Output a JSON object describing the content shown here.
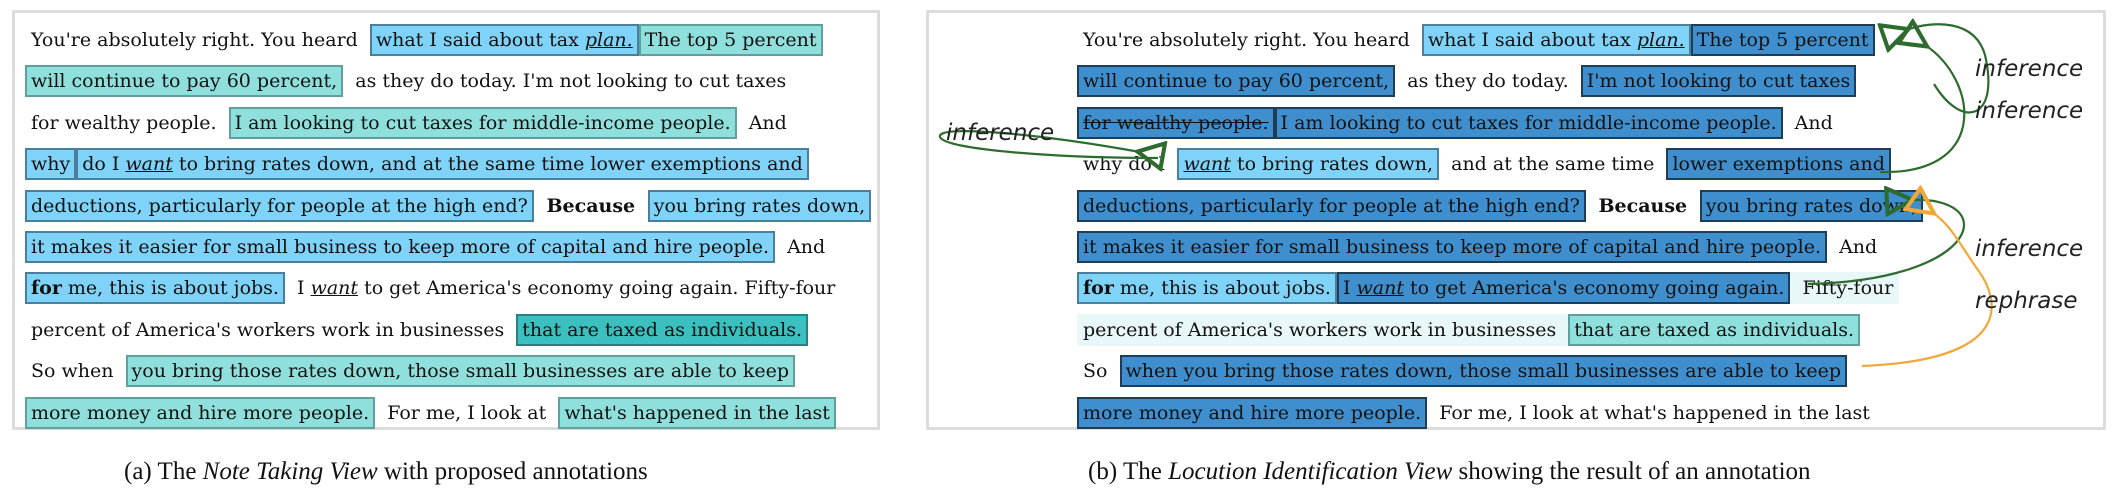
{
  "panel_a": {
    "lines": [
      [
        {
          "t": "You're absolutely right. You heard ",
          "c": "plain"
        },
        {
          "t": "what I said about tax ",
          "c": "light",
          "tail": "plan.",
          "tail_style": "it"
        },
        {
          "t": "The top 5 percent",
          "c": "teal"
        }
      ],
      [
        {
          "t": "will continue to pay 60 percent,",
          "c": "teal"
        },
        {
          "t": " as they do today. I'm not looking to cut taxes",
          "c": "plain"
        }
      ],
      [
        {
          "t": "for wealthy people. ",
          "c": "plain"
        },
        {
          "t": "I am looking to cut taxes for middle-income people.",
          "c": "teal"
        },
        {
          "t": " And",
          "c": "plain"
        }
      ],
      [
        {
          "t": "why",
          "c": "light"
        },
        {
          "t": "do I ",
          "c": "light",
          "tail": "want",
          "tail_style": "it",
          "after": " to bring rates down, and at the same time lower exemptions and"
        }
      ],
      [
        {
          "t": "deductions, particularly for people at the high end?",
          "c": "light"
        },
        {
          "t": " Because ",
          "c": "plain",
          "bold": true
        },
        {
          "t": "you bring rates down,",
          "c": "light"
        }
      ],
      [
        {
          "t": "it makes it easier for small business to keep more of capital and hire people.",
          "c": "light"
        },
        {
          "t": " And",
          "c": "plain"
        }
      ],
      [
        {
          "t": "for",
          "c": "light",
          "bold_head": true,
          "after": " me, this is about jobs."
        },
        {
          "t": " I ",
          "c": "plain",
          "tail": "want",
          "tail_style": "it",
          "after": " to get America's economy going again. Fifty-four"
        }
      ],
      [
        {
          "t": "percent of America's workers work in businesses ",
          "c": "plain"
        },
        {
          "t": "that are taxed as individuals.",
          "c": "teal2"
        }
      ],
      [
        {
          "t": "So when ",
          "c": "plain"
        },
        {
          "t": "you bring those rates down, those small businesses are able to keep",
          "c": "teal"
        }
      ],
      [
        {
          "t": "more money and hire more people.",
          "c": "teal"
        },
        {
          "t": " For me, I look at ",
          "c": "plain"
        },
        {
          "t": "what's happened in the last",
          "c": "teal"
        }
      ]
    ]
  },
  "panel_b": {
    "lines": [
      [
        {
          "t": "You're absolutely right. You heard ",
          "c": "plain"
        },
        {
          "t": "what I said about tax ",
          "c": "light",
          "tail": "plan.",
          "tail_style": "it"
        },
        {
          "t": "The top 5 percent",
          "c": "dark"
        }
      ],
      [
        {
          "t": "will continue to pay 60 percent,",
          "c": "dark"
        },
        {
          "t": " as they do today. ",
          "c": "plain"
        },
        {
          "t": "I'm not looking to cut taxes",
          "c": "dark"
        }
      ],
      [
        {
          "t": "for wealthy people.",
          "c": "dark",
          "strike": true
        },
        {
          "t": "I am looking to cut taxes for middle-income people.",
          "c": "dark"
        },
        {
          "t": " And",
          "c": "plain"
        }
      ],
      [
        {
          "t": "why do I ",
          "c": "plain"
        },
        {
          "t": "want",
          "c": "light",
          "tail_only_it": true,
          "after": " to bring rates down,"
        },
        {
          "t": " and at the same time ",
          "c": "plain"
        },
        {
          "t": "lower exemptions and",
          "c": "dark"
        }
      ],
      [
        {
          "t": "deductions, particularly for people at the high end?",
          "c": "dark"
        },
        {
          "t": " Because ",
          "c": "plain",
          "bold": true
        },
        {
          "t": "you bring rates down,",
          "c": "dark"
        }
      ],
      [
        {
          "t": "it makes it easier for small business to keep more of capital and hire people.",
          "c": "dark"
        },
        {
          "t": " And",
          "c": "plain"
        }
      ],
      [
        {
          "t": "for",
          "c": "light",
          "bold_head": true,
          "after": " me, this is about jobs."
        },
        {
          "t": "I ",
          "c": "dark",
          "tail": "want",
          "tail_style": "it",
          "after": " to get America's economy going again."
        },
        {
          "t": " Fifty-four",
          "c": "pale"
        }
      ],
      [
        {
          "t": "percent of America's workers work in businesses ",
          "c": "pale"
        },
        {
          "t": "that are taxed as individuals.",
          "c": "teal"
        }
      ],
      [
        {
          "t": "So ",
          "c": "plain"
        },
        {
          "t": "when you bring those rates down, those small businesses are able to keep",
          "c": "dark"
        }
      ],
      [
        {
          "t": "more money and hire more people.",
          "c": "dark"
        },
        {
          "t": " For me, I look at what's happened in the last",
          "c": "plain"
        }
      ]
    ],
    "relations": [
      {
        "label": "inference",
        "color": "#2e6b2e"
      },
      {
        "label": "inference",
        "color": "#2e6b2e"
      },
      {
        "label": "inference",
        "color": "#2e6b2e"
      },
      {
        "label": "inference",
        "color": "#2e6b2e"
      },
      {
        "label": "rephrase",
        "color": "#f2a838"
      }
    ]
  },
  "captions": {
    "a_prefix": "(a) The ",
    "a_emph": "Note Taking View",
    "a_suffix": " with proposed annotations",
    "b_prefix": "(b) The ",
    "b_emph": "Locution Identification View",
    "b_suffix": " showing the result of an annotation"
  }
}
